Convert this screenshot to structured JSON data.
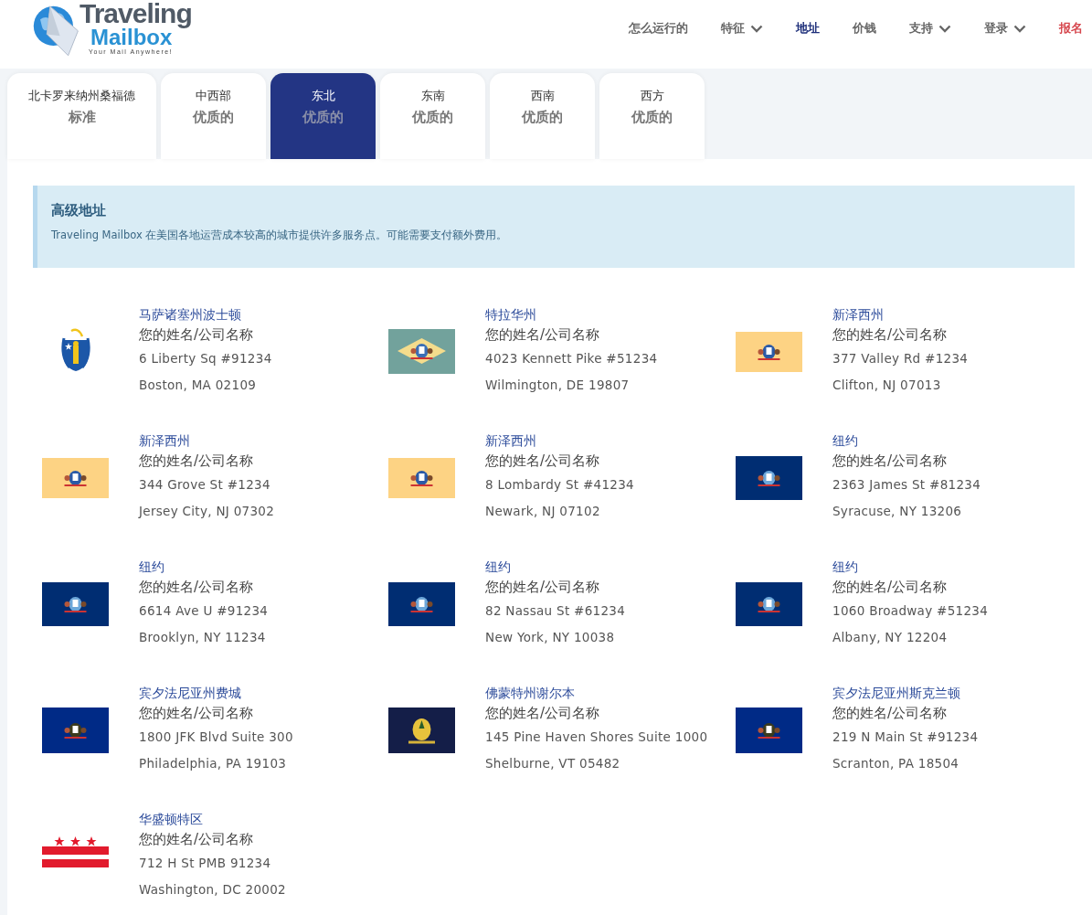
{
  "logo": {
    "line1": "Traveling",
    "line2": "Mailbox",
    "tagline": "Your Mail Anywhere!"
  },
  "nav": [
    {
      "label": "怎么运行的",
      "dropdown": false,
      "kind": "link",
      "selected": false
    },
    {
      "label": "特征",
      "dropdown": true,
      "kind": "link",
      "selected": false
    },
    {
      "label": "地址",
      "dropdown": false,
      "kind": "link",
      "selected": true
    },
    {
      "label": "价钱",
      "dropdown": false,
      "kind": "link",
      "selected": false
    },
    {
      "label": "支持",
      "dropdown": true,
      "kind": "link",
      "selected": false
    },
    {
      "label": "登录",
      "dropdown": true,
      "kind": "link",
      "selected": false
    },
    {
      "label": "报名",
      "dropdown": false,
      "kind": "cta",
      "selected": false
    }
  ],
  "tabs": [
    {
      "region": "北卡罗来纳州桑福德",
      "tier": "标准",
      "selected": false
    },
    {
      "region": "中西部",
      "tier": "优质的",
      "selected": false
    },
    {
      "region": "东北",
      "tier": "优质的",
      "selected": true
    },
    {
      "region": "东南",
      "tier": "优质的",
      "selected": false
    },
    {
      "region": "西南",
      "tier": "优质的",
      "selected": false
    },
    {
      "region": "西方",
      "tier": "优质的",
      "selected": false
    }
  ],
  "notice": {
    "title": "高级地址",
    "text": "Traveling Mailbox 在美国各地运营成本较高的城市提供许多服务点。可能需要支付额外费用。"
  },
  "addresses": [
    {
      "kind": "ma",
      "location": "马萨诸塞州波士顿",
      "name": "您的姓名/公司名称",
      "street": "6 Liberty Sq #91234",
      "city": "Boston, MA 02109"
    },
    {
      "kind": "de",
      "location": "特拉华州",
      "name": "您的姓名/公司名称",
      "street": "4023 Kennett Pike #51234",
      "city": "Wilmington, DE 19807"
    },
    {
      "kind": "nj",
      "location": "新泽西州",
      "name": "您的姓名/公司名称",
      "street": "377 Valley Rd #1234",
      "city": "Clifton, NJ 07013"
    },
    {
      "kind": "nj",
      "location": "新泽西州",
      "name": "您的姓名/公司名称",
      "street": "344 Grove St #1234",
      "city": "Jersey City, NJ 07302"
    },
    {
      "kind": "nj",
      "location": "新泽西州",
      "name": "您的姓名/公司名称",
      "street": "8 Lombardy St #41234",
      "city": "Newark, NJ 07102"
    },
    {
      "kind": "ny",
      "location": "纽约",
      "name": "您的姓名/公司名称",
      "street": "2363 James St #81234",
      "city": "Syracuse, NY 13206"
    },
    {
      "kind": "ny",
      "location": "纽约",
      "name": "您的姓名/公司名称",
      "street": "6614 Ave U #91234",
      "city": "Brooklyn, NY 11234"
    },
    {
      "kind": "ny",
      "location": "纽约",
      "name": "您的姓名/公司名称",
      "street": "82 Nassau St #61234",
      "city": "New York, NY 10038"
    },
    {
      "kind": "ny",
      "location": "纽约",
      "name": "您的姓名/公司名称",
      "street": "1060 Broadway #51234",
      "city": "Albany, NY 12204"
    },
    {
      "kind": "pa",
      "location": "宾夕法尼亚州费城",
      "name": "您的姓名/公司名称",
      "street": "1800 JFK Blvd Suite 300",
      "city": "Philadelphia, PA 19103"
    },
    {
      "kind": "vt",
      "location": "佛蒙特州谢尔本",
      "name": "您的姓名/公司名称",
      "street": "145 Pine Haven Shores Suite 1000",
      "city": "Shelburne, VT 05482"
    },
    {
      "kind": "pa",
      "location": "宾夕法尼亚州斯克兰顿",
      "name": "您的姓名/公司名称",
      "street": "219 N Main St #91234",
      "city": "Scranton, PA 18504"
    },
    {
      "kind": "dc",
      "location": "华盛顿特区",
      "name": "您的姓名/公司名称",
      "street": "712 H St PMB 91234",
      "city": "Washington, DC 20002"
    }
  ]
}
